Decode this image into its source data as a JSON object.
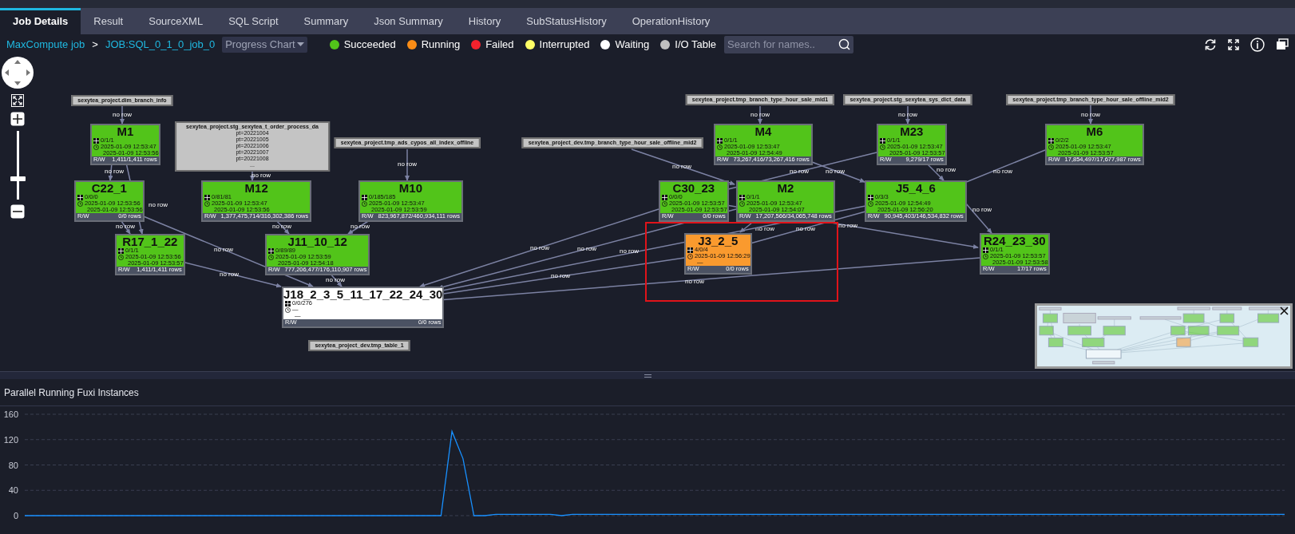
{
  "tabs": [
    {
      "label": "Job Details",
      "selected": true
    },
    {
      "label": "Result",
      "selected": false
    },
    {
      "label": "SourceXML",
      "selected": false
    },
    {
      "label": "SQL Script",
      "selected": false
    },
    {
      "label": "Summary",
      "selected": false
    },
    {
      "label": "Json Summary",
      "selected": false
    },
    {
      "label": "History",
      "selected": false
    },
    {
      "label": "SubStatusHistory",
      "selected": false
    },
    {
      "label": "OperationHistory",
      "selected": false
    }
  ],
  "breadcrumb": {
    "root": "MaxCompute job",
    "separator": ">",
    "job": "JOB:SQL_0_1_0_job_0"
  },
  "view_select": {
    "value": "Progress Chart"
  },
  "legend": [
    {
      "label": "Succeeded",
      "color": "#52c41a"
    },
    {
      "label": "Running",
      "color": "#fa8c16"
    },
    {
      "label": "Failed",
      "color": "#f5222d"
    },
    {
      "label": "Interrupted",
      "color": "#ffff66"
    },
    {
      "label": "Waiting",
      "color": "#ffffff"
    },
    {
      "label": "I/O Table",
      "color": "#bfbfbf"
    }
  ],
  "search": {
    "placeholder": "Search for names.."
  },
  "zoom_slider": {
    "level": 0.3
  },
  "tables": [
    {
      "name": "sexytea_project.dim_branch_info"
    },
    {
      "name": "sexytea_project.stg_sexytea_t_order_process_da",
      "partitions": [
        "pt=20221004",
        "pt=20221005",
        "pt=20221006",
        "pt=20221007",
        "pt=20221008",
        "..."
      ]
    },
    {
      "name": "sexytea_project.tmp_ads_cypos_all_index_offline"
    },
    {
      "name": "sexytea_project_dev.tmp_branch_type_hour_sale_offline_mid2"
    },
    {
      "name": "sexytea_project.tmp_branch_type_hour_sale_mid1"
    },
    {
      "name": "sexytea_project.stg_sexytea_sys_dict_data"
    },
    {
      "name": "sexytea_project.tmp_branch_type_hour_sale_offline_mid2"
    },
    {
      "name": "sexytea_project_dev.tmp_table_1"
    }
  ],
  "nodes": [
    {
      "title": "M1",
      "color": "#52c41a",
      "instances": "0/1/1",
      "start": "2025-01-09 12:53:47",
      "end": "2025-01-09 12:53:56",
      "rw": "R/W",
      "rows": "1,411/1,411 rows"
    },
    {
      "title": "C22_1",
      "color": "#52c41a",
      "instances": "0/0/0",
      "start": "2025-01-09 12:53:56",
      "end": "2025-01-09 12:53:56",
      "rw": "R/W",
      "rows": "0/0 rows"
    },
    {
      "title": "M12",
      "color": "#52c41a",
      "instances": "0/81/81",
      "start": "2025-01-09 12:53:47",
      "end": "2025-01-09 12:53:56",
      "rw": "R/W",
      "rows": "1,377,475,714/316,302,386 rows"
    },
    {
      "title": "M10",
      "color": "#52c41a",
      "instances": "0/185/185",
      "start": "2025-01-09 12:53:47",
      "end": "2025-01-09 12:53:59",
      "rw": "R/W",
      "rows": "823,967,872/460,934,111 rows"
    },
    {
      "title": "R17_1_22",
      "color": "#52c41a",
      "instances": "0/1/1",
      "start": "2025-01-09 12:53:56",
      "end": "2025-01-09 12:53:57",
      "rw": "R/W",
      "rows": "1,411/1,411 rows"
    },
    {
      "title": "J11_10_12",
      "color": "#52c41a",
      "instances": "0/89/89",
      "start": "2025-01-09 12:53:59",
      "end": "2025-01-09 12:54:18",
      "rw": "R/W",
      "rows": "777,206,477/176,110,907 rows"
    },
    {
      "title": "J18_2_3_5_11_17_22_24_30",
      "color": "#ffffff",
      "instances": "0/0/276",
      "start": "—",
      "end": "—",
      "rw": "R/W",
      "rows": "0/0 rows"
    },
    {
      "title": "C30_23",
      "color": "#52c41a",
      "instances": "0/0/0",
      "start": "2025-01-09 12:53:57",
      "end": "2025-01-09 12:53:57",
      "rw": "R/W",
      "rows": "0/0 rows"
    },
    {
      "title": "M2",
      "color": "#52c41a",
      "instances": "0/1/1",
      "start": "2025-01-09 12:53:47",
      "end": "2025-01-09 12:54:07",
      "rw": "R/W",
      "rows": "17,207,566/34,065,748 rows"
    },
    {
      "title": "M4",
      "color": "#52c41a",
      "instances": "0/1/1",
      "start": "2025-01-09 12:53:47",
      "end": "2025-01-09 12:54:49",
      "rw": "R/W",
      "rows": "73,267,416/73,267,416 rows"
    },
    {
      "title": "M23",
      "color": "#52c41a",
      "instances": "0/1/1",
      "start": "2025-01-09 12:53:47",
      "end": "2025-01-09 12:53:57",
      "rw": "R/W",
      "rows": "9,279/17 rows"
    },
    {
      "title": "J5_4_6",
      "color": "#52c41a",
      "instances": "0/3/3",
      "start": "2025-01-09 12:54:49",
      "end": "2025-01-09 12:56:20",
      "rw": "R/W",
      "rows": "90,945,403/146,534,832 rows"
    },
    {
      "title": "J3_2_5",
      "color": "#fa9a2e",
      "instances": "4/0/4",
      "start": "2025-01-09 12:56:29",
      "end": "—",
      "rw": "R/W",
      "rows": "0/0 rows"
    },
    {
      "title": "R24_23_30",
      "color": "#52c41a",
      "instances": "0/1/1",
      "start": "2025-01-09 12:53:57",
      "end": "2025-01-09 12:53:58",
      "rw": "R/W",
      "rows": "17/17 rows"
    },
    {
      "title": "M6",
      "color": "#52c41a",
      "instances": "0/2/2",
      "start": "2025-01-09 12:53:47",
      "end": "2025-01-09 12:53:57",
      "rw": "R/W",
      "rows": "17,854,497/17,677,987 rows"
    }
  ],
  "edges": [
    {
      "label": "no row"
    },
    {
      "label": "no row"
    },
    {
      "label": "no row"
    },
    {
      "label": "no row"
    },
    {
      "label": "no row"
    },
    {
      "label": "no row"
    },
    {
      "label": "no row"
    },
    {
      "label": "no row"
    },
    {
      "label": "no row"
    },
    {
      "label": "no row"
    },
    {
      "label": "no row"
    },
    {
      "label": "no row"
    },
    {
      "label": "no row"
    },
    {
      "label": "no row"
    },
    {
      "label": "no row"
    },
    {
      "label": "no row"
    },
    {
      "label": "no row"
    },
    {
      "label": "no row"
    },
    {
      "label": "no row"
    },
    {
      "label": "no row"
    },
    {
      "label": "no row"
    },
    {
      "label": "no row"
    },
    {
      "label": "no row"
    },
    {
      "label": "no row"
    },
    {
      "label": "no row"
    },
    {
      "label": "no row"
    },
    {
      "label": "no row"
    },
    {
      "label": "no row"
    }
  ],
  "chart": {
    "title": "Parallel Running Fuxi Instances",
    "chart_data": {
      "type": "line",
      "categories": [
        null,
        null,
        null,
        null,
        null,
        null,
        null,
        null,
        null,
        null,
        null,
        null,
        null,
        null,
        null,
        null,
        null,
        null,
        null,
        null,
        null,
        null,
        null,
        null,
        null,
        null,
        null,
        null,
        null,
        null,
        null,
        null,
        null,
        null,
        null,
        null,
        null,
        null,
        null,
        null,
        null,
        null,
        null,
        null,
        null,
        null,
        null,
        null,
        null,
        null,
        null,
        null,
        null,
        null,
        null,
        null,
        null,
        null,
        null,
        null,
        null,
        null,
        null,
        null,
        null,
        null,
        null,
        null,
        null,
        null,
        null,
        null,
        null,
        null,
        null,
        null,
        null,
        null,
        null,
        null,
        null,
        null,
        null,
        null,
        null,
        null,
        null,
        null,
        null,
        null,
        null,
        null,
        null,
        null,
        null,
        null,
        null,
        null,
        null,
        null,
        null,
        null,
        null,
        null,
        null,
        null,
        null,
        null,
        null,
        null,
        null,
        null,
        null,
        null,
        null,
        null
      ],
      "ylim": [
        0,
        160
      ],
      "grid": true,
      "yticks": [
        {
          "value": 0,
          "label": "0"
        },
        {
          "value": 40,
          "label": "40"
        },
        {
          "value": 80,
          "label": "80"
        },
        {
          "value": 120,
          "label": "120"
        },
        {
          "value": 160,
          "label": "160"
        }
      ],
      "series": [
        {
          "color": "#1890ff",
          "values": [
            0,
            0,
            0,
            0,
            0,
            0,
            0,
            0,
            0,
            0,
            0,
            0,
            0,
            0,
            0,
            0,
            0,
            0,
            0,
            0,
            0,
            0,
            0,
            0,
            0,
            0,
            0,
            0,
            0,
            0,
            0,
            0,
            0,
            0,
            0,
            0,
            0,
            0,
            0,
            133,
            90,
            0,
            0,
            2,
            2,
            2,
            2,
            2,
            2,
            0,
            2,
            2,
            2,
            2,
            2,
            2,
            2,
            2,
            2,
            2,
            2,
            2,
            2,
            2,
            2,
            2,
            2,
            2,
            2,
            2,
            2,
            2,
            2,
            2,
            2,
            2,
            2,
            2,
            2,
            2,
            2,
            2,
            2,
            2,
            2,
            2,
            2,
            2,
            2,
            2,
            2,
            2,
            2,
            2,
            2,
            2,
            2,
            2,
            2,
            2,
            2,
            2,
            2,
            2,
            2,
            2,
            2,
            2,
            2,
            2,
            2,
            2,
            2,
            2,
            2,
            2
          ]
        }
      ]
    }
  }
}
